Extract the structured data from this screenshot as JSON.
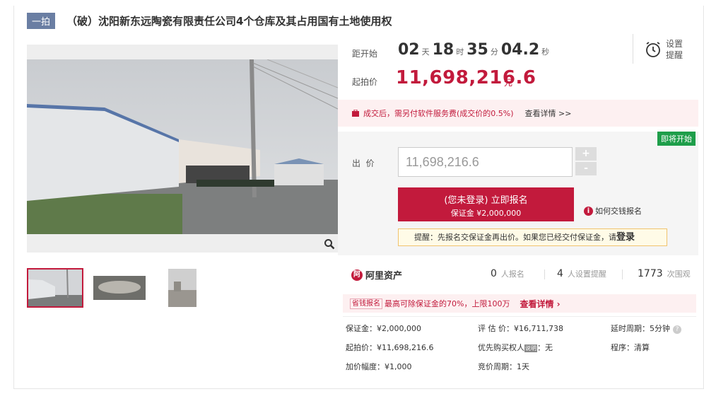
{
  "listing": {
    "badge": "一拍",
    "title": "（破）沈阳新东远陶瓷有限责任公司4个仓库及其占用国有土地使用权"
  },
  "countdown": {
    "label": "距开始",
    "days": "02",
    "days_unit": "天",
    "hours": "18",
    "hours_unit": "时",
    "minutes": "35",
    "minutes_unit": "分",
    "seconds": "04.2",
    "seconds_unit": "秒"
  },
  "reminder": {
    "label": "设置提醒"
  },
  "start_price": {
    "label": "起拍价",
    "value": "11,698,216.6",
    "unit": "元"
  },
  "fee_notice": {
    "text": "成交后，需另付软件服务费(成交价的0.5%)",
    "link": "查看详情 >>"
  },
  "bid": {
    "status_badge": "即将开始",
    "label": "出  价",
    "value": "11,698,216.6",
    "plus": "+",
    "minus": "-",
    "signup_line1": "(您未登录) 立即报名",
    "signup_line2": "保证金 ¥2,000,000",
    "howto": "如何交钱报名",
    "tip_prefix": "提醒：先报名交保证金再出价。如果您已经交付保证金，请",
    "tip_login": "登录"
  },
  "stats": {
    "brand": "阿里资产",
    "signups": "0",
    "signups_label": "人报名",
    "reminders": "4",
    "reminders_label": "人设置提醒",
    "views": "1773",
    "views_label": "次围观"
  },
  "deposit_bar": {
    "tag": "省钱报名",
    "text": "最高可除保证金的70%，上限100万",
    "link": "查看详情 ›"
  },
  "info": {
    "deposit": "保证金：¥2,000,000",
    "appraisal": "评 估 价：¥16,711,738",
    "delay": "延时周期：5分钟",
    "start_price": "起拍价：¥11,698,216.6",
    "priority_label": "优先购买权人",
    "priority_tag": "说明",
    "priority_value": "：无",
    "procedure": "程序：清算",
    "increment": "加价幅度：¥1,000",
    "bid_period": "竞价周期：1天"
  },
  "colors": {
    "accent": "#c21a3c",
    "badge_blue": "#6a7ea3",
    "soon_green": "#1e9e4a"
  },
  "icons": [
    "zoom-icon",
    "alarm-clock-icon",
    "fee-warning-icon",
    "help-icon"
  ]
}
